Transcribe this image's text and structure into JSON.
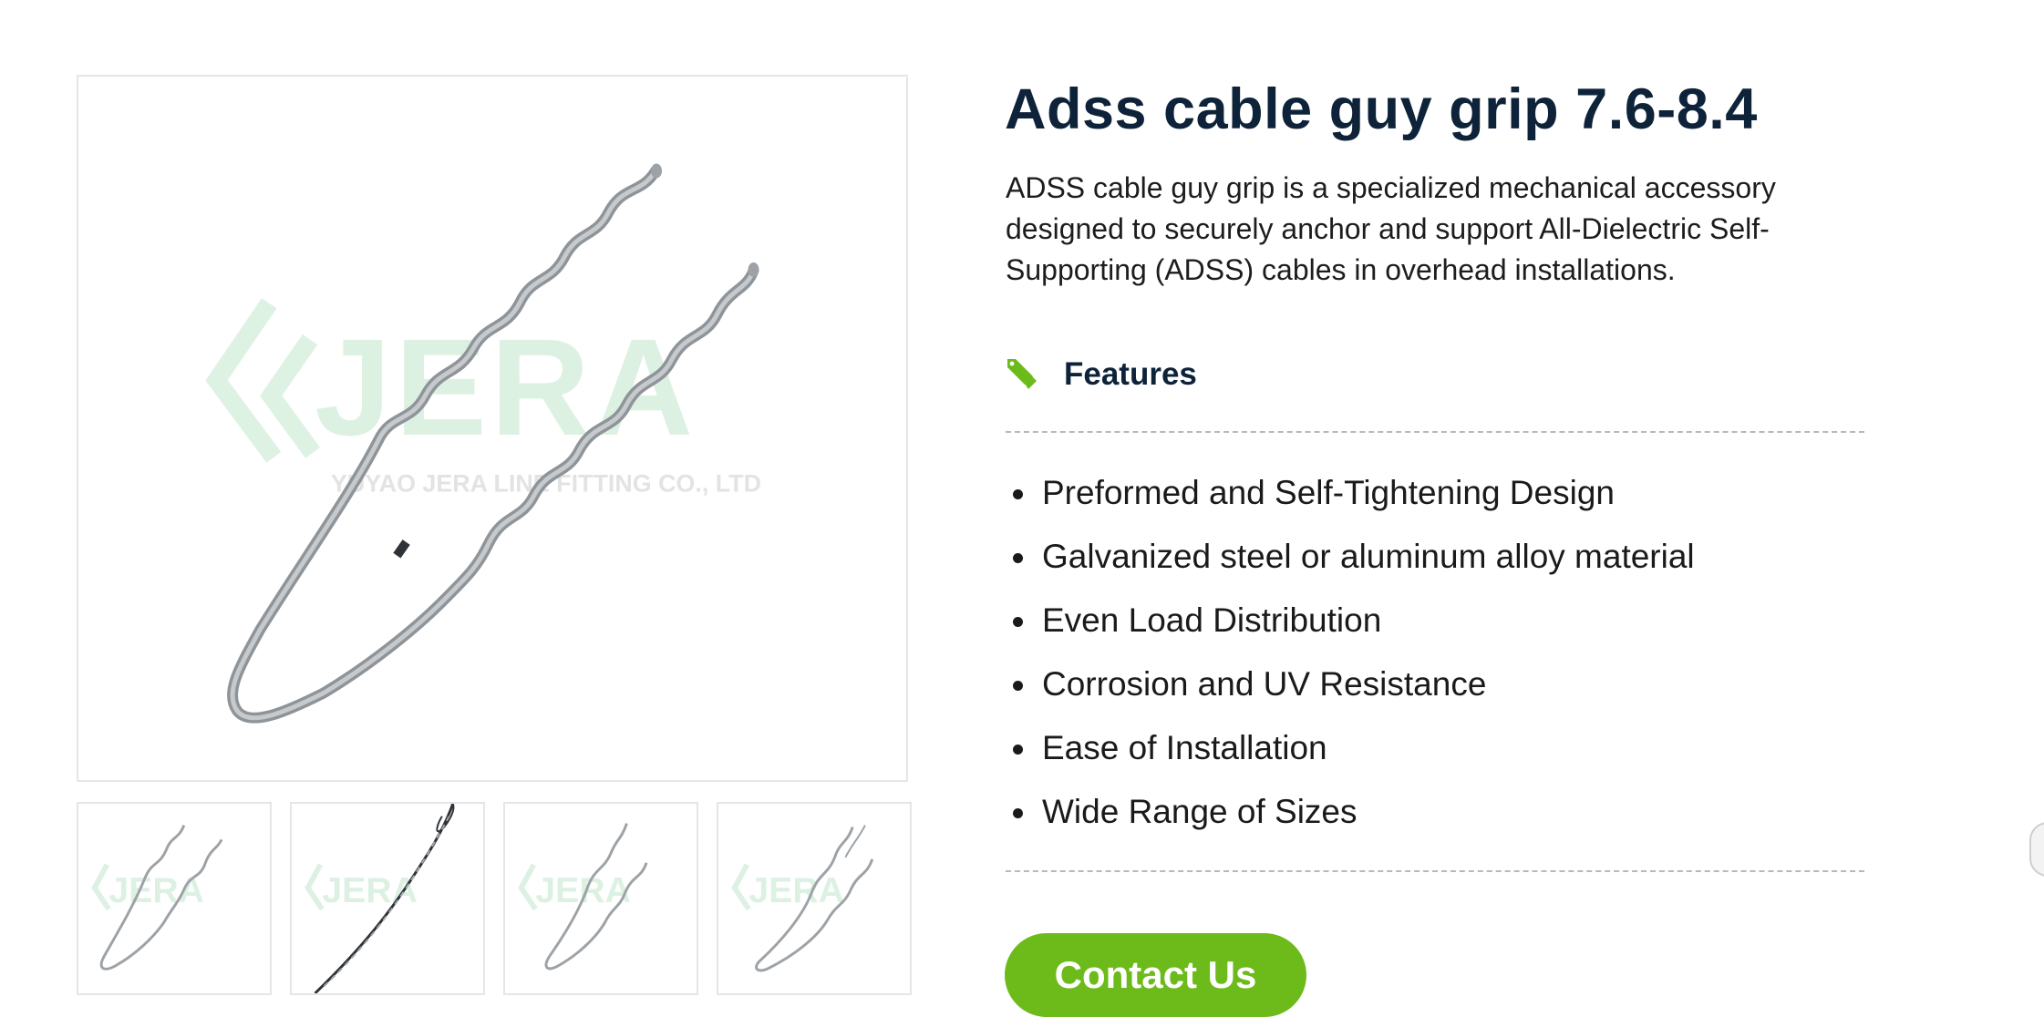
{
  "product": {
    "title": "Adss cable guy grip 7.6-8.4",
    "description": "ADSS cable guy grip is a specialized mechanical accessory designed to securely anchor and support All-Dielectric Self-Supporting (ADSS) cables in overhead installations.",
    "image_watermark": {
      "logo_text": "JERA",
      "company_text": "YUYAO JERA LINE FITTING CO., LTD"
    }
  },
  "features": {
    "heading": "Features",
    "icon": "tag-icon",
    "items": [
      "Preformed and Self-Tightening Design",
      "Galvanized steel or aluminum alloy material",
      "Even Load Distribution",
      "Corrosion and UV Resistance",
      "Ease of Installation",
      "Wide Range of Sizes"
    ]
  },
  "cta": {
    "label": "Contact Us"
  },
  "colors": {
    "title": "#0e2339",
    "accent_green": "#6dbb1a",
    "watermark_green": "#d9f0e0",
    "wire": "#a9adb1"
  }
}
